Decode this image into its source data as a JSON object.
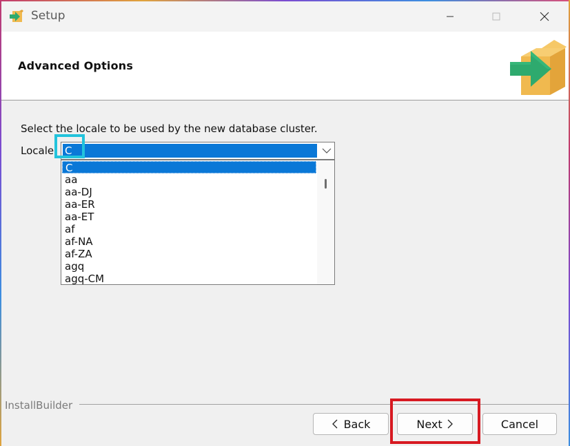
{
  "window": {
    "title": "Setup"
  },
  "header": {
    "title": "Advanced Options"
  },
  "main": {
    "description": "Select the locale to be used by the new database cluster.",
    "locale_label": "Locale",
    "locale_selected": "C",
    "locale_options": [
      "C",
      "aa",
      "aa-DJ",
      "aa-ER",
      "aa-ET",
      "af",
      "af-NA",
      "af-ZA",
      "agq",
      "agq-CM"
    ]
  },
  "footer": {
    "brand": "InstallBuilder",
    "back_label": "Back",
    "next_label": "Next",
    "cancel_label": "Cancel"
  },
  "icons": {
    "app": "installer-arrow-box-icon",
    "logo": "installer-arrow-box-icon",
    "minimize": "minimize-icon",
    "maximize": "maximize-icon",
    "close": "close-icon",
    "dropdown": "chevron-down-icon"
  },
  "colors": {
    "selection": "#0a78d7",
    "highlight_cyan": "#22c3dc",
    "highlight_red": "#d71921",
    "logo_box": "#f0b94f",
    "logo_arrow": "#2eaa6e"
  }
}
